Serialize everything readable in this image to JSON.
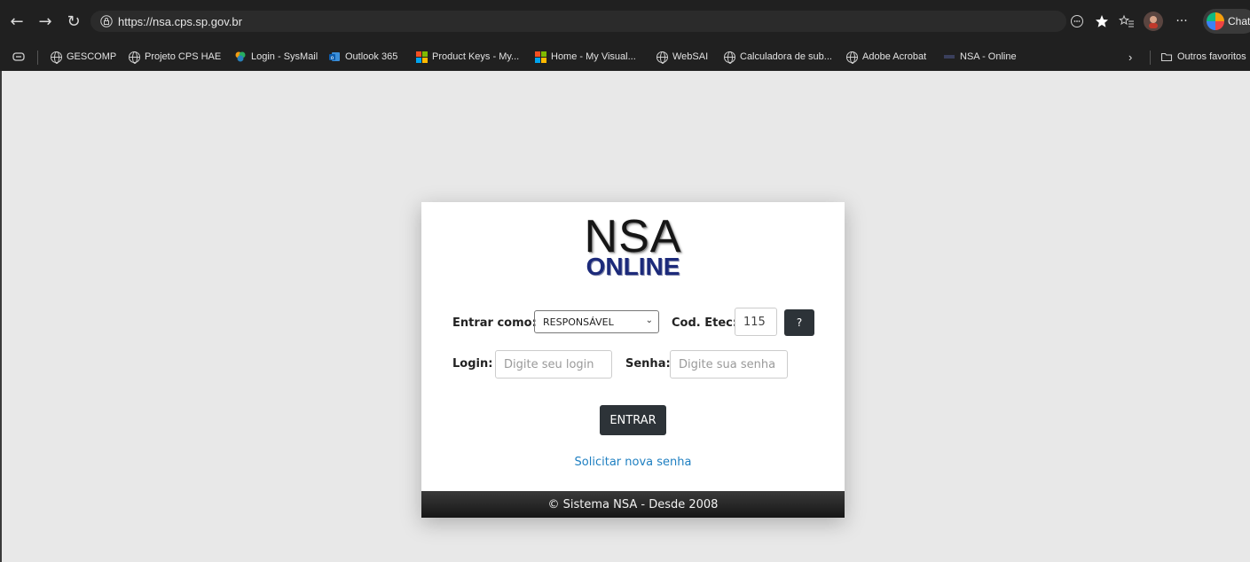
{
  "browser": {
    "url": "https://nsa.cps.sp.gov.br",
    "chat_label": "Chat",
    "more_label": "···"
  },
  "bookmarks": [
    {
      "label": "GESCOMP",
      "icon": "globe-icon"
    },
    {
      "label": "Projeto CPS HAE",
      "icon": "globe-icon"
    },
    {
      "label": "Login - SysMail",
      "icon": "sysmail-icon"
    },
    {
      "label": "Outlook 365",
      "icon": "outlook-icon"
    },
    {
      "label": "Product Keys - My...",
      "icon": "microsoft-icon"
    },
    {
      "label": "Home - My Visual...",
      "icon": "microsoft-icon"
    },
    {
      "label": "WebSAI",
      "icon": "globe-icon"
    },
    {
      "label": "Calculadora de sub...",
      "icon": "globe-icon"
    },
    {
      "label": "Adobe Acrobat",
      "icon": "globe-icon"
    },
    {
      "label": "NSA - Online",
      "icon": "nsa-icon"
    }
  ],
  "other_favorites": "Outros favoritos",
  "login": {
    "logo_top": "NSA",
    "logo_bottom": "ONLINE",
    "role_label": "Entrar como:",
    "role_value": "RESPONSÁVEL",
    "code_label": "Cod. Etec:",
    "code_value": "115",
    "help_button": "?",
    "login_label": "Login:",
    "login_placeholder": "Digite seu login",
    "password_label": "Senha:",
    "password_placeholder": "Digite sua senha",
    "submit_label": "ENTRAR",
    "forgot_link": "Solicitar nova senha",
    "footer": "© Sistema NSA - Desde 2008"
  },
  "colors": {
    "button_dark": "#2d3338",
    "link": "#1e7fc1",
    "logo_online": "#1c2a7a",
    "page_bg": "#e8e8e8"
  }
}
